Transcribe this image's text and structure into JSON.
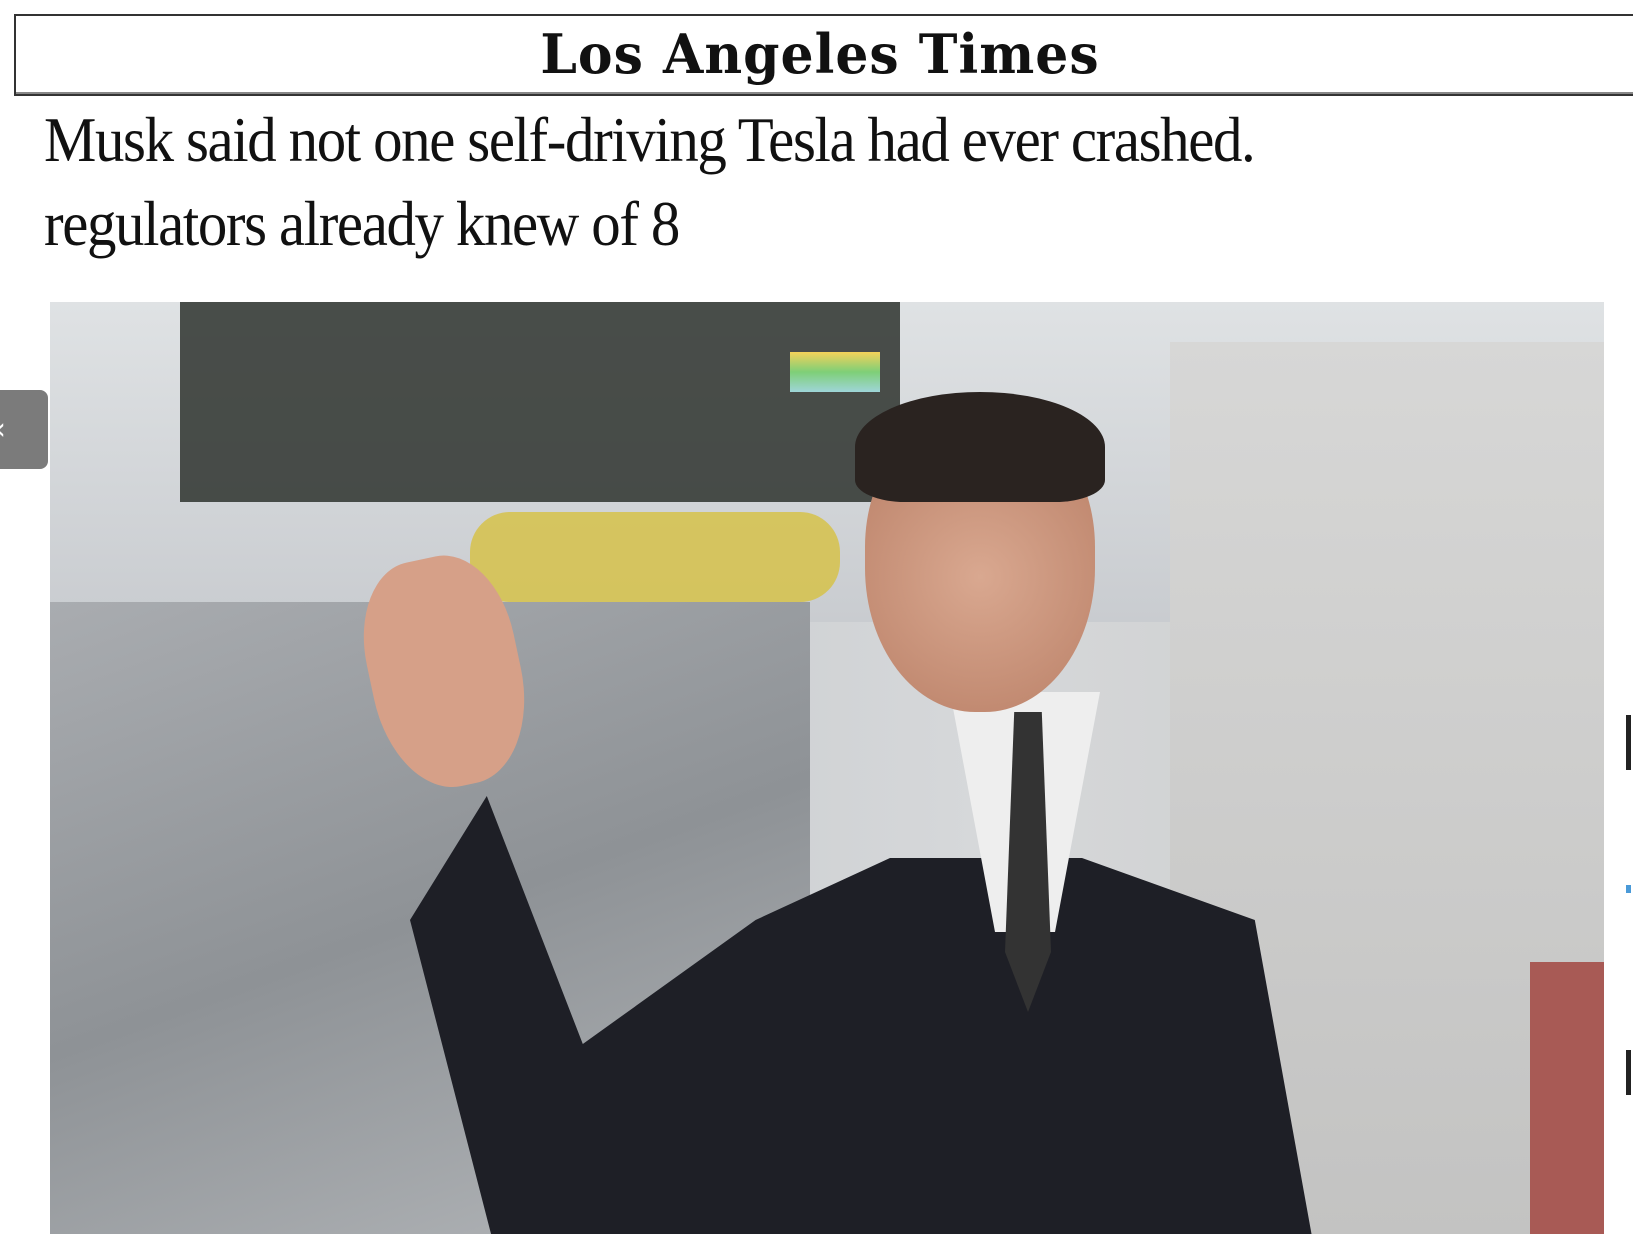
{
  "masthead": {
    "logo": "Los Angeles Times"
  },
  "article": {
    "headline_line1": "Musk said not one self-driving Tesla had ever crashed.",
    "headline_line2": "regulators already knew of 8"
  },
  "photo": {
    "subject": "lead-photo"
  },
  "nav": {
    "back_icon": "chevron-left-icon",
    "back_glyph": "‹"
  }
}
